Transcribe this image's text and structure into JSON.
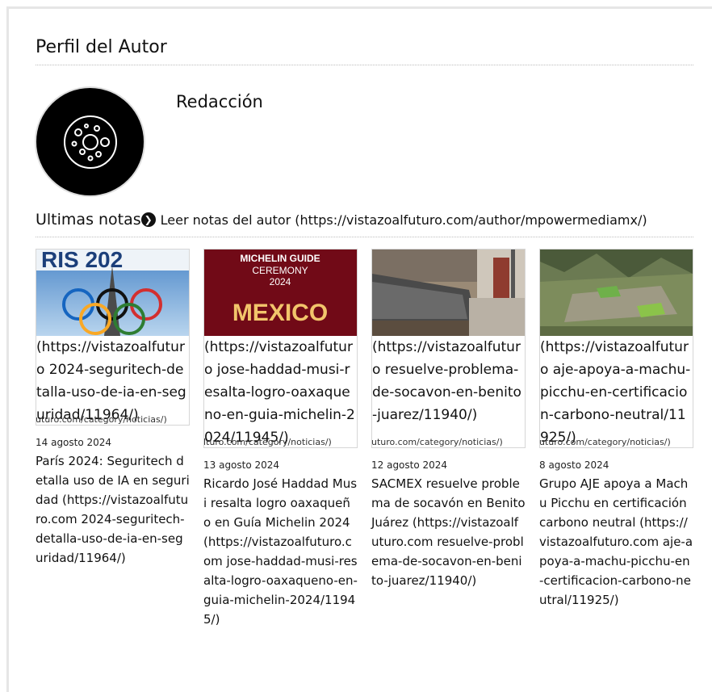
{
  "profile": {
    "section_title": "Perfil del Autor",
    "author_name": "Redacción"
  },
  "notes": {
    "title": "Ultimas notas",
    "read_more_label": "Leer notas del autor (https://vistazoalfuturo.com/author/mpowermediamx/)"
  },
  "cards": [
    {
      "thumb_text": "RIS 202",
      "overlay": "(https://vistazoalfuturo 2024-seguritech-detalla-uso-de-ia-en-seguridad/11964/)",
      "category": "uturo.com/category/noticias/)",
      "date": "14 agosto 2024",
      "title": "París 2024: Seguritech detalla uso de IA en seguridad (https://vistazoalfuturo.com 2024-seguritech-detalla-uso-de-ia-en-seguridad/11964/)"
    },
    {
      "thumb_text_1": "MICHELIN GUIDE",
      "thumb_text_2": "CEREMONY",
      "thumb_text_3": "2024",
      "thumb_text_4": "MEXICO",
      "overlay": "(https://vistazoalfuturo jose-haddad-musi-resalta-logro-oaxaqueno-en-guia-michelin-2024/11945/)",
      "category": "lturo.com/category/noticias/)",
      "date": "13 agosto 2024",
      "title": "Ricardo José Haddad Musi resalta logro oaxaqueño en Guía Michelin 2024 (https://vistazoalfuturo.com jose-haddad-musi-resalta-logro-oaxaqueno-en-guia-michelin-2024/11945/)"
    },
    {
      "overlay": "(https://vistazoalfuturo resuelve-problema-de-socavon-en-benito-juarez/11940/)",
      "category": "uturo.com/category/noticias/)",
      "date": "12 agosto 2024",
      "title": "SACMEX resuelve problema de socavón en Benito Juárez (https://vistazoalfuturo.com resuelve-problema-de-socavon-en-benito-juarez/11940/)"
    },
    {
      "overlay": "(https://vistazoalfuturo aje-apoya-a-machu-picchu-en-certificacion-carbono-neutral/11925/)",
      "category": "uturo.com/category/noticias/)",
      "date": "8 agosto 2024",
      "title": "Grupo AJE apoya a Machu Picchu en certificación carbono neutral (https://vistazoalfuturo.com aje-apoya-a-machu-picchu-en-certificacion-carbono-neutral/11925/)"
    }
  ],
  "colors": {
    "text": "#111111",
    "border": "#d6d6d6",
    "divider": "#bdbdbd"
  },
  "icons": {
    "avatar": "planet-circles-icon",
    "read_more": "circle-chevron-right-icon"
  }
}
